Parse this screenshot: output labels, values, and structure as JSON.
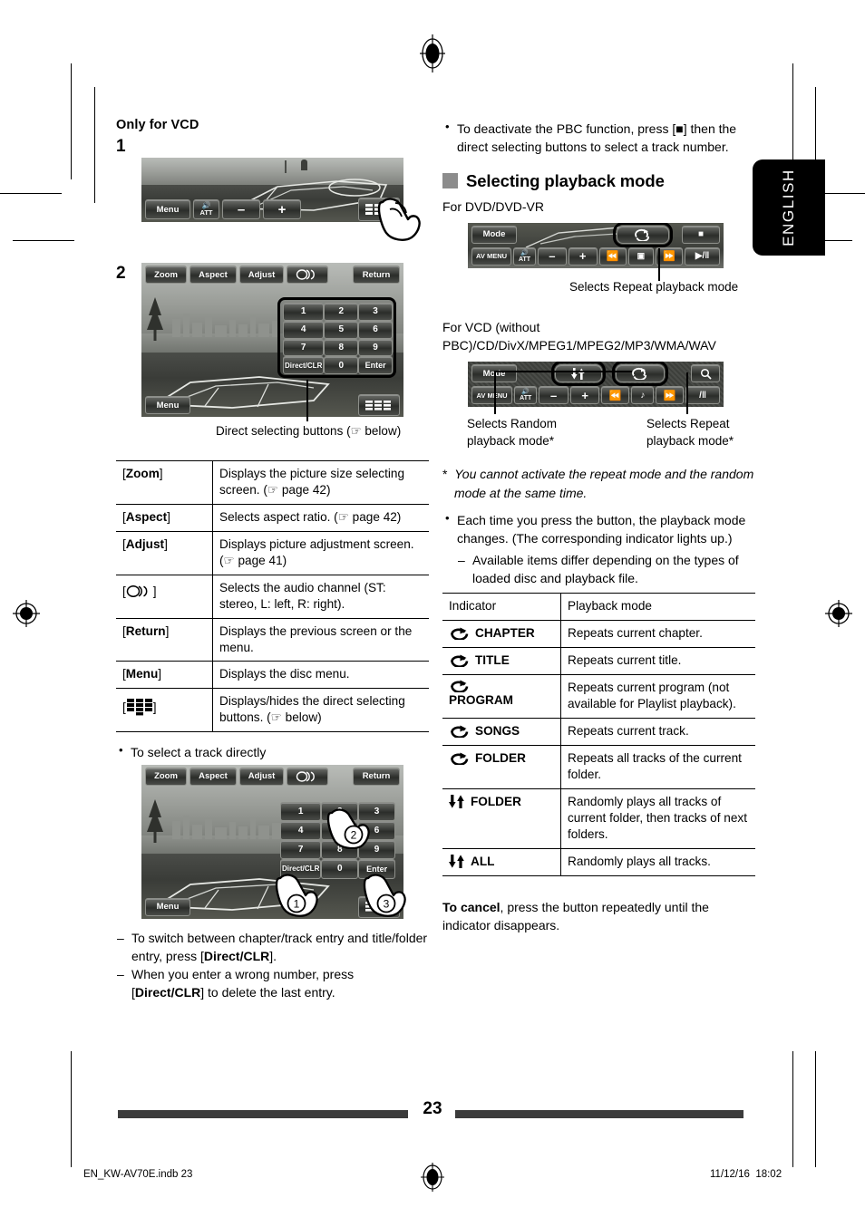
{
  "page": {
    "number": "23",
    "side_tab": "ENGLISH",
    "footer_file": "EN_KW-AV70E.indb   23",
    "footer_date": "11/12/16",
    "footer_time": "18:02"
  },
  "left": {
    "heading": "Only for VCD",
    "step1_label": "1",
    "step2_label": "2",
    "figure1": {
      "buttons": [
        "Menu",
        "ATT",
        "–",
        "+"
      ],
      "att_label": "ATT",
      "keypad_toggle_name": "direct-selecting-buttons-icon"
    },
    "figure2": {
      "top_buttons": [
        "Zoom",
        "Aspect",
        "Adjust",
        "○))"
      ],
      "return_button": "Return",
      "menu_button": "Menu",
      "keys": [
        "1",
        "2",
        "3",
        "4",
        "5",
        "6",
        "7",
        "8",
        "9",
        "Direct/CLR",
        "0",
        "Enter"
      ]
    },
    "figure2_caption": "Direct selecting buttons (☞ below)",
    "table": {
      "rows": [
        {
          "key": "[Zoom]",
          "key_bold": "Zoom",
          "desc": "Displays the picture size selecting screen. (☞ page 42)"
        },
        {
          "key": "[Aspect]",
          "key_bold": "Aspect",
          "desc": "Selects aspect ratio. (☞ page 42)"
        },
        {
          "key": "[Adjust]",
          "key_bold": "Adjust",
          "desc": "Displays picture adjustment screen. (☞ page 41)"
        },
        {
          "key": "[○))]",
          "key_bold": "audio-channel-icon",
          "desc": "Selects the audio channel (ST: stereo, L: left, R: right)."
        },
        {
          "key": "[Return]",
          "key_bold": "Return",
          "desc": "Displays the previous screen or the menu."
        },
        {
          "key": "[Menu]",
          "key_bold": "Menu",
          "desc": "Displays the disc menu."
        },
        {
          "key": "[keypad]",
          "key_bold": "keypad-icon",
          "desc": "Displays/hides the direct selecting buttons. (☞ below)"
        }
      ]
    },
    "select_track_bullet": "To select a track directly",
    "figure3": {
      "top_buttons": [
        "Zoom",
        "Aspect",
        "Adjust",
        "○))"
      ],
      "return_button": "Return",
      "menu_button": "Menu",
      "keys": [
        "1",
        "2",
        "3",
        "4",
        "5",
        "6",
        "7",
        "8",
        "9",
        "Direct/CLR",
        "0",
        "Enter"
      ],
      "markers": [
        "1",
        "2",
        "3"
      ]
    },
    "notes": [
      "To switch between chapter/track entry and title/folder entry, press [Direct/CLR].",
      "When you enter a wrong number, press [Direct/CLR] to delete the last entry."
    ]
  },
  "right": {
    "pbc_bullet": "To deactivate the PBC function, press [■] then the direct selecting buttons to select a track number.",
    "section_title": "Selecting playback mode",
    "dvd_label": "For DVD/DVD-VR",
    "dvd_bar": {
      "mode": "Mode",
      "av_menu": "AV MENU",
      "att": "ATT",
      "minus": "–",
      "plus": "+",
      "prev": "⏮",
      "stop": "■",
      "next": "⏭",
      "playpause": "▶/‖",
      "repeat": "repeat-icon",
      "stop_right": "■"
    },
    "dvd_caption": "Selects Repeat playback mode",
    "vcd_label": "For VCD (without PBC)/CD/DivX/MPEG1/MPEG2/MP3/WMA/WAV",
    "vcd_bar": {
      "mode": "Mode",
      "av_menu": "AV MENU",
      "att": "ATT",
      "minus": "–",
      "plus": "+",
      "prev": "⏮",
      "note": "♪",
      "next": "⏭",
      "playpause": "/‖",
      "random": "random-icon",
      "repeat": "repeat-icon",
      "search": "search-icon"
    },
    "vcd_caption_left": "Selects Random playback mode*",
    "vcd_caption_right": "Selects Repeat playback mode*",
    "footnote": "* You cannot activate the repeat mode and the random mode at the same time.",
    "bullet_mode_change": "Each time you press the button, the playback mode changes. (The corresponding indicator lights up.)",
    "dash_available": "Available items differ depending on the types of loaded disc and playback file.",
    "table": {
      "headers": [
        "Indicator",
        "Playback mode"
      ],
      "rows": [
        {
          "icon": "repeat-icon",
          "label": "CHAPTER",
          "desc": "Repeats current chapter."
        },
        {
          "icon": "repeat-icon",
          "label": "TITLE",
          "desc": "Repeats current title."
        },
        {
          "icon": "repeat-icon",
          "label": "PROGRAM",
          "desc": "Repeats current program (not available for Playlist playback).",
          "wrap": true
        },
        {
          "icon": "repeat-icon",
          "label": "SONGS",
          "desc": "Repeats current track."
        },
        {
          "icon": "repeat-icon",
          "label": "FOLDER",
          "desc": "Repeats all tracks of the current folder."
        },
        {
          "icon": "random-icon",
          "label": "FOLDER",
          "desc": "Randomly plays all tracks of current folder, then tracks of next folders."
        },
        {
          "icon": "random-icon",
          "label": "ALL",
          "desc": "Randomly plays all tracks."
        }
      ]
    },
    "cancel_bold": "To cancel",
    "cancel_rest": ", press the button repeatedly until the indicator disappears."
  }
}
